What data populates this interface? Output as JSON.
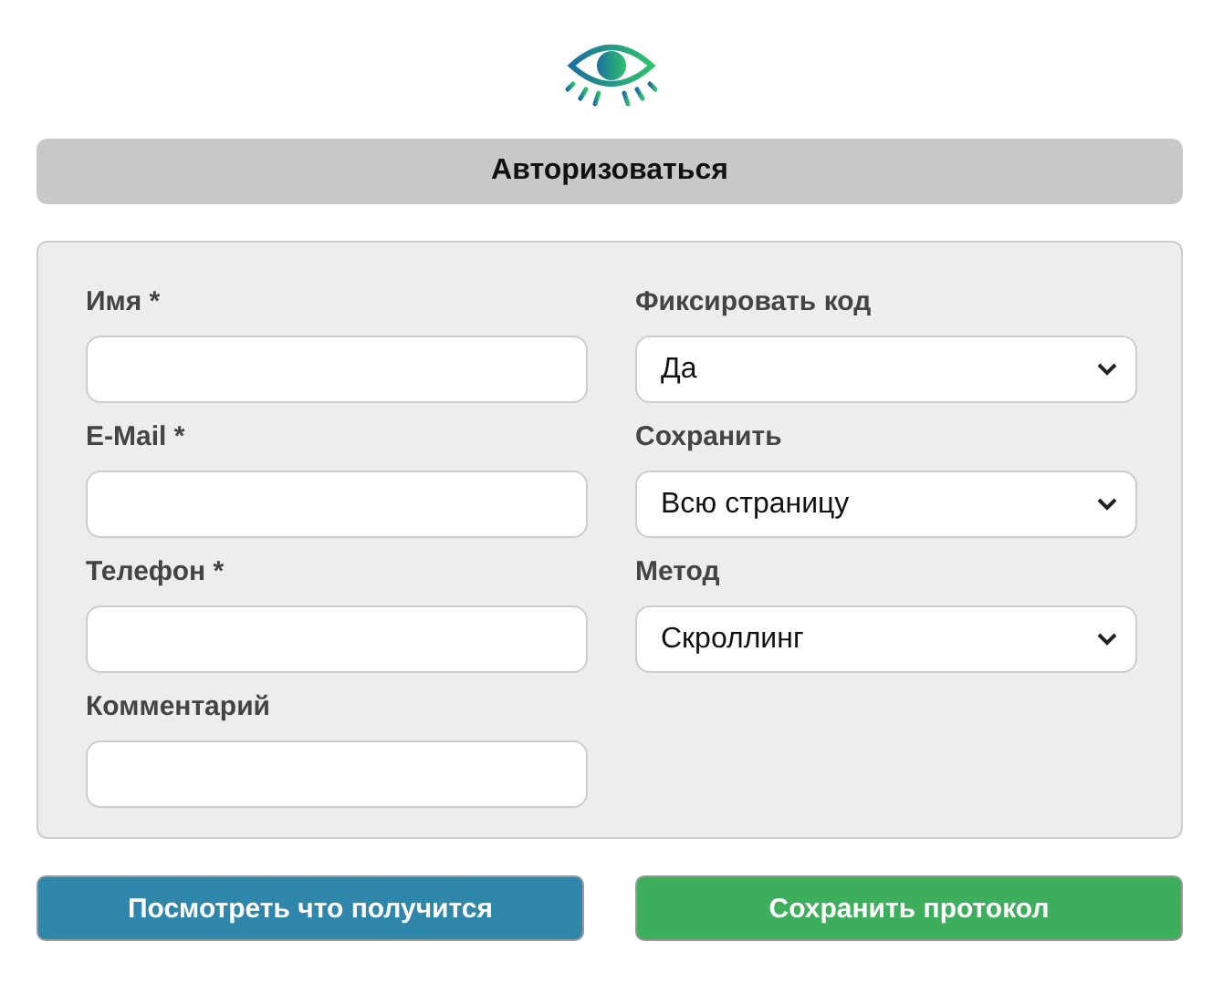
{
  "header": {
    "title": "Авторизоваться"
  },
  "form": {
    "columns": [
      {
        "fields": [
          {
            "kind": "input",
            "label": "Имя *"
          },
          {
            "kind": "input",
            "label": "E-Mail *"
          },
          {
            "kind": "input",
            "label": "Телефон *"
          },
          {
            "kind": "input",
            "label": "Комментарий"
          }
        ]
      },
      {
        "fields": [
          {
            "kind": "select",
            "label": "Фиксировать код",
            "value": "Да"
          },
          {
            "kind": "select",
            "label": "Сохранить",
            "value": "Всю страницу"
          },
          {
            "kind": "select",
            "label": "Метод",
            "value": "Скроллинг"
          }
        ]
      }
    ]
  },
  "buttons": [
    {
      "kind": "preview",
      "label": "Посмотреть что получится"
    },
    {
      "kind": "save",
      "label": "Сохранить протокол"
    }
  ]
}
